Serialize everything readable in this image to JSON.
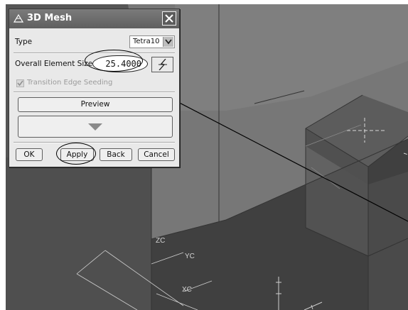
{
  "dialog": {
    "title": "3D Mesh",
    "type_label": "Type",
    "type_value": "Tetra10",
    "size_label": "Overall Element Size",
    "size_value": "25.4000",
    "transition_label": "Transition Edge Seeding",
    "transition_checked": true,
    "transition_enabled": false,
    "preview_label": "Preview",
    "buttons": {
      "ok": "OK",
      "apply": "Apply",
      "back": "Back",
      "cancel": "Cancel"
    }
  },
  "viewport": {
    "axis_labels": {
      "zc": "ZC",
      "yc": "YC",
      "xc": "XC"
    },
    "background_color": "#565656"
  },
  "icons": [
    "mesh-icon",
    "close-icon",
    "dropdown-arrow-icon",
    "lightning-icon",
    "checkmark-icon",
    "expand-triangle-icon"
  ]
}
